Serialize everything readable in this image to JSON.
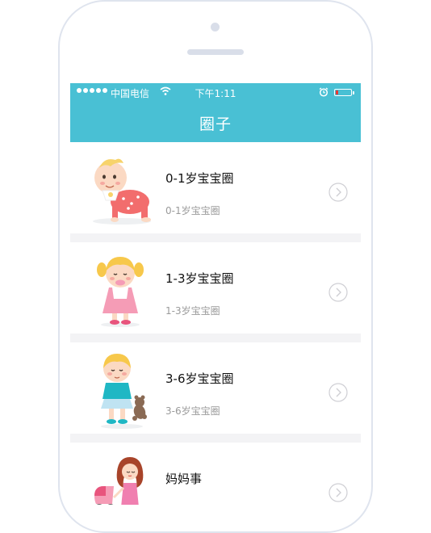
{
  "status_bar": {
    "carrier": "中国电信",
    "time": "下午1:11",
    "icons": [
      "signal-dots",
      "wifi-icon",
      "alarm-icon",
      "battery-icon"
    ]
  },
  "nav": {
    "title": "圈子"
  },
  "circles": [
    {
      "title": "0-1岁宝宝圈",
      "subtitle": "0-1岁宝宝圈",
      "icon": "crawling-baby-illustration"
    },
    {
      "title": "1-3岁宝宝圈",
      "subtitle": "1-3岁宝宝圈",
      "icon": "toddler-girl-illustration"
    },
    {
      "title": "3-6岁宝宝圈",
      "subtitle": "3-6岁宝宝圈",
      "icon": "child-with-teddy-illustration"
    },
    {
      "title": "妈妈事",
      "subtitle": "",
      "icon": "mother-with-stroller-illustration"
    }
  ],
  "colors": {
    "header": "#49c0d4",
    "list_background": "#f3f3f5",
    "title_text": "#111111",
    "subtitle_text": "#9a9a9a",
    "battery_low": "#e53935"
  }
}
